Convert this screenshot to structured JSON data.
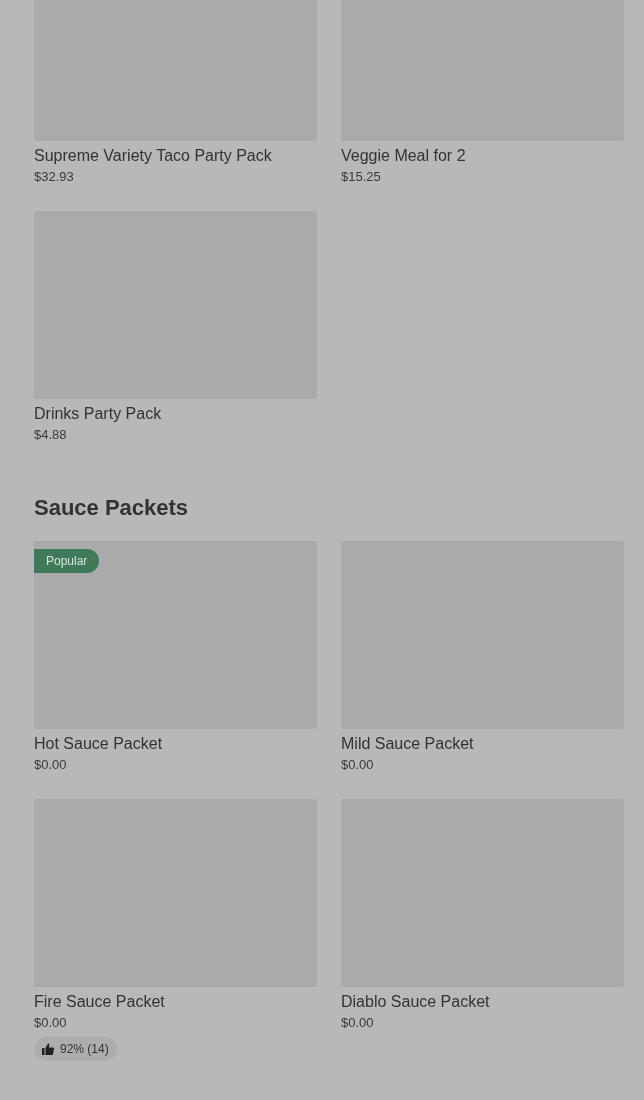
{
  "sections": [
    {
      "items": [
        {
          "name": "Supreme Variety Taco Party Pack",
          "price": "$32.93"
        },
        {
          "name": "Veggie Meal for 2",
          "price": "$15.25"
        },
        {
          "name": "Drinks Party Pack",
          "price": "$4.88"
        }
      ]
    },
    {
      "title": "Sauce Packets",
      "items": [
        {
          "name": "Hot Sauce Packet",
          "price": "$0.00",
          "badge": "Popular"
        },
        {
          "name": "Mild Sauce Packet",
          "price": "$0.00"
        },
        {
          "name": "Fire Sauce Packet",
          "price": "$0.00",
          "rating": "92% (14)"
        },
        {
          "name": "Diablo Sauce Packet",
          "price": "$0.00"
        }
      ]
    }
  ]
}
